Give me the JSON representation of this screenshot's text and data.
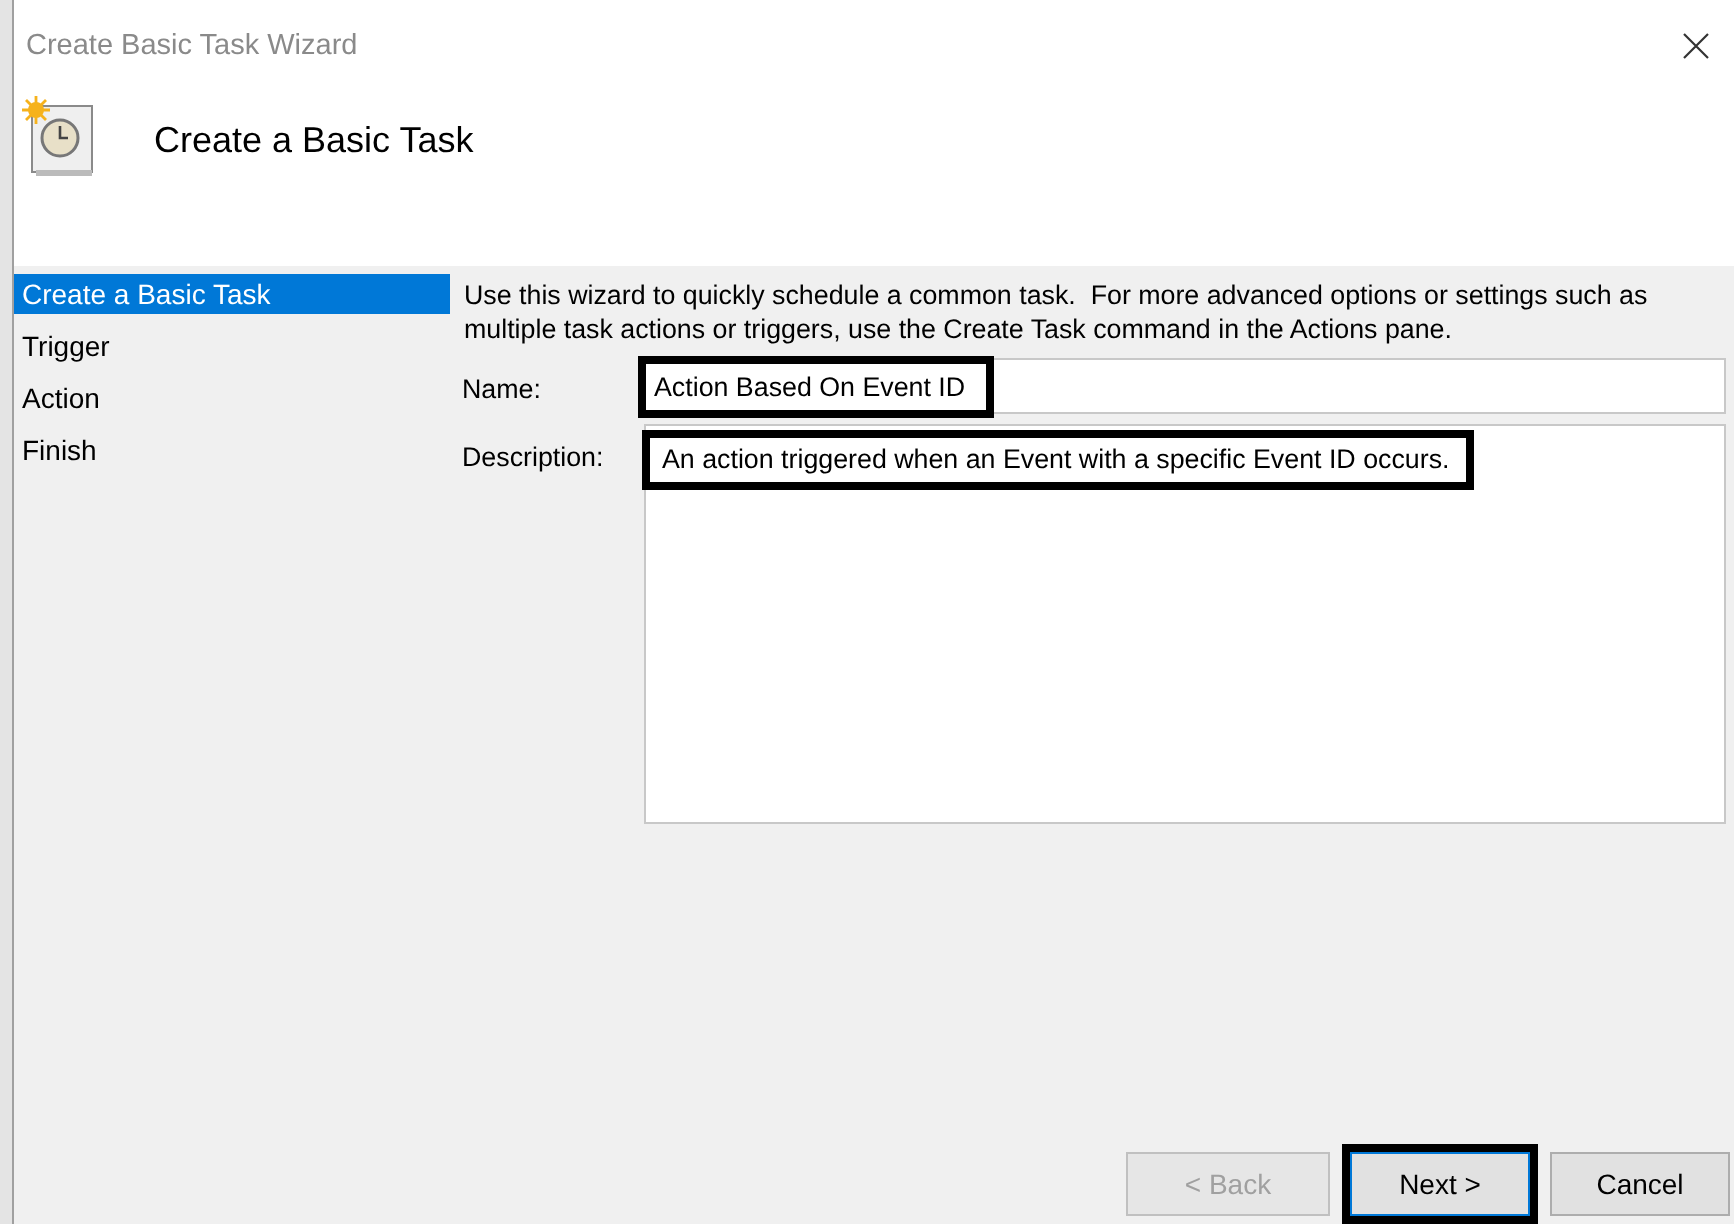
{
  "window": {
    "title": "Create Basic Task Wizard"
  },
  "header": {
    "title": "Create a Basic Task"
  },
  "steps": [
    {
      "label": "Create a Basic Task",
      "selected": true
    },
    {
      "label": "Trigger",
      "selected": false
    },
    {
      "label": "Action",
      "selected": false
    },
    {
      "label": "Finish",
      "selected": false
    }
  ],
  "intro": "Use this wizard to quickly schedule a common task.  For more advanced options or settings such as multiple task actions or triggers, use the Create Task command in the Actions pane.",
  "name": {
    "label": "Name:",
    "value": "Action Based On Event ID",
    "highlighted": true
  },
  "description": {
    "label": "Description:",
    "value": "An action triggered when an Event with a specific Event ID occurs.",
    "highlighted": true
  },
  "buttons": [
    {
      "label": "< Back",
      "disabled": true,
      "highlighted": false
    },
    {
      "label": "Next >",
      "disabled": false,
      "highlighted": true
    },
    {
      "label": "Cancel",
      "disabled": false,
      "highlighted": false
    }
  ]
}
